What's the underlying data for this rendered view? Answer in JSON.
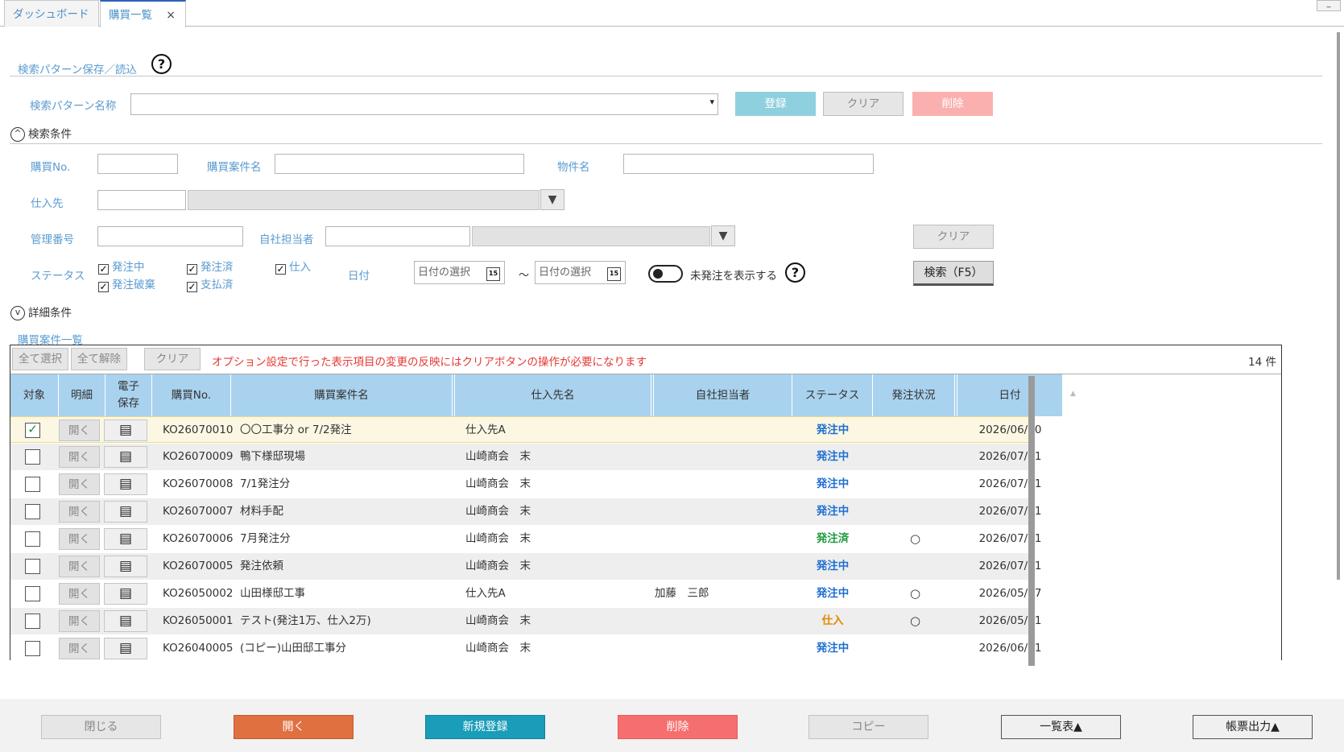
{
  "tabs": [
    {
      "label": "ダッシュボード"
    },
    {
      "label": "購買一覧",
      "close": "×"
    }
  ],
  "window": {
    "min": "_"
  },
  "pattern": {
    "section_label": "検索パターン保存／読込",
    "help": "?",
    "name_label": "検索パターン名称",
    "select_arrow": "▾",
    "register": "登録",
    "clear": "クリア",
    "delete": "削除"
  },
  "conditions": {
    "toggle_label": "検索条件",
    "toggle_icon": "^",
    "purchase_no": "購買No.",
    "case_name": "購買案件名",
    "property_name": "物件名",
    "supplier": "仕入先",
    "mgmt_no": "管理番号",
    "staff": "自社担当者",
    "clear": "クリア",
    "status_label": "ステータス",
    "date_label": "日付",
    "search": "検索（F5）",
    "statuses": [
      {
        "label": "発注中",
        "checked": "✓"
      },
      {
        "label": "発注済",
        "checked": "✓"
      },
      {
        "label": "仕入",
        "checked": "✓"
      },
      {
        "label": "発注破棄",
        "checked": "✓"
      },
      {
        "label": "支払済",
        "checked": "✓"
      }
    ],
    "date_from": "日付の選択",
    "date_to": "日付の選択",
    "tilde": "～",
    "cal_icon": "15",
    "toggle_unordered": "未発注を表示する",
    "help": "?"
  },
  "detail": {
    "toggle_label": "詳細条件",
    "toggle_icon": "v"
  },
  "list": {
    "title": "購買案件一覧",
    "select_all": "全て選択",
    "deselect_all": "全て解除",
    "clear": "クリア",
    "notice": "オプション設定で行った表示項目の変更の反映にはクリアボタンの操作が必要になります",
    "count": "14 件",
    "headers": [
      "対象",
      "明細",
      "電子\n保存",
      "購買No.",
      "購買案件名",
      "仕入先名",
      "自社担当者",
      "ステータス",
      "発注状況",
      "日付"
    ],
    "open_label": "開く",
    "doc_icon": "▤",
    "rows": [
      {
        "checked": "✓",
        "no": "KO26070010",
        "name": "〇〇工事分 or 7/2発注",
        "supplier": "仕入先A",
        "staff": "",
        "status": "発注中",
        "order": "",
        "date": "2026/06/30"
      },
      {
        "checked": "",
        "no": "KO26070009",
        "name": "鴨下様邸現場",
        "supplier": "山崎商会　末",
        "staff": "",
        "status": "発注中",
        "order": "",
        "date": "2026/07/01"
      },
      {
        "checked": "",
        "no": "KO26070008",
        "name": "7/1発注分",
        "supplier": "山崎商会　末",
        "staff": "",
        "status": "発注中",
        "order": "",
        "date": "2026/07/01"
      },
      {
        "checked": "",
        "no": "KO26070007",
        "name": "材料手配",
        "supplier": "山崎商会　末",
        "staff": "",
        "status": "発注中",
        "order": "",
        "date": "2026/07/01"
      },
      {
        "checked": "",
        "no": "KO26070006",
        "name": "7月発注分",
        "supplier": "山崎商会　末",
        "staff": "",
        "status": "発注済",
        "order": "○",
        "date": "2026/07/01"
      },
      {
        "checked": "",
        "no": "KO26070005",
        "name": "発注依頼",
        "supplier": "山崎商会　末",
        "staff": "",
        "status": "発注中",
        "order": "",
        "date": "2026/07/01"
      },
      {
        "checked": "",
        "no": "KO26050002",
        "name": "山田様邸工事",
        "supplier": "仕入先A",
        "staff": "加藤　三郎",
        "status": "発注中",
        "order": "○",
        "date": "2026/05/07"
      },
      {
        "checked": "",
        "no": "KO26050001",
        "name": "テスト(発注1万、仕入2万)",
        "supplier": "山崎商会　末",
        "staff": "",
        "status": "仕入",
        "order": "○",
        "date": "2026/05/01"
      },
      {
        "checked": "",
        "no": "KO26040005",
        "name": "(コピー)山田邸工事分",
        "supplier": "山崎商会　末",
        "staff": "",
        "status": "発注中",
        "order": "",
        "date": "2026/06/01"
      }
    ]
  },
  "footer": {
    "close": "閉じる",
    "open": "開く",
    "new": "新規登録",
    "delete": "削除",
    "copy": "コピー",
    "list_table": "一覧表▲",
    "report": "帳票出力▲"
  },
  "colors": {
    "label": "#5a9bd0",
    "header_bg": "#a9d2ee",
    "open_btn": "#e07040",
    "new_btn": "#1a9db8",
    "delete_btn": "#f56f6f",
    "register_btn": "#8fd0df",
    "status_ordering": "#1f6fd1",
    "status_ordered": "#1e9a3e",
    "status_stock": "#e08a00",
    "notice": "#e53935"
  }
}
